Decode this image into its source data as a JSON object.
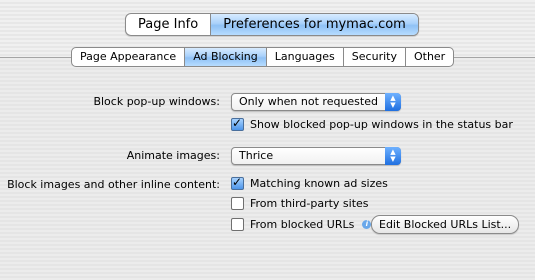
{
  "top_tabs": [
    {
      "label": "Page Info",
      "active": false
    },
    {
      "label": "Preferences for mymac.com",
      "active": true
    }
  ],
  "sub_tabs": [
    {
      "label": "Page Appearance",
      "active": false
    },
    {
      "label": "Ad Blocking",
      "active": true
    },
    {
      "label": "Languages",
      "active": false
    },
    {
      "label": "Security",
      "active": false
    },
    {
      "label": "Other",
      "active": false
    }
  ],
  "popups": {
    "label": "Block pop-up windows:",
    "value": "Only when not requested"
  },
  "show_blocked": {
    "label": "Show blocked pop-up windows in the status bar",
    "checked": true
  },
  "animate": {
    "label": "Animate images:",
    "value": "Thrice"
  },
  "block_images": {
    "label": "Block images and other inline content:",
    "options": [
      {
        "label": "Matching known ad sizes",
        "checked": true
      },
      {
        "label": "From third-party sites",
        "checked": false
      },
      {
        "label": "From blocked URLs",
        "checked": false
      }
    ]
  },
  "edit_button": "Edit Blocked URLs List...",
  "colors": {
    "accent": "#8fc1f5",
    "popup_arrow": "#1f6fe0"
  }
}
